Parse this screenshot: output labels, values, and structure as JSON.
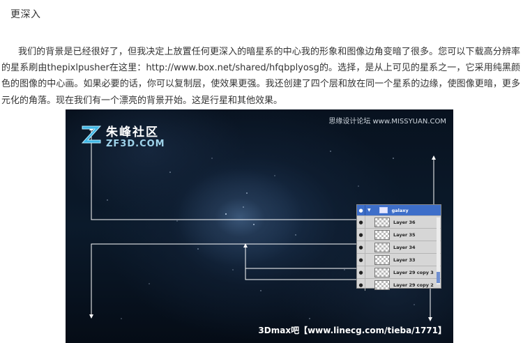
{
  "heading": "更深入",
  "paragraph": "我们的背景是已经很好了，但我决定上放置任何更深入的暗星系的中心我的形象和图像边角变暗了很多。您可以下载高分辨率的星系刷由thepixlpusher在这里：http://www.box.net/shared/hfqbplyosg的。选择，是从上可见的星系之一，它采用纯黑颜色的图像的中心画。如果必要的话，你可以复制层，使效果更强。我还创建了四个层和放在同一个星系的边缘，使图像更暗，更多元化的角落。现在我们有一个漂亮的背景开始。这是行星和其他效果。",
  "screenshot": {
    "logo_cn": "朱峰社区",
    "logo_en": "ZF3D.COM",
    "watermark_top": "思缘设计论坛 www.MISSYUAN.COM",
    "watermark_bottom": "3Dmax吧【www.linecg.com/tieba/1771】",
    "layers": [
      {
        "name": "galaxy",
        "type": "group"
      },
      {
        "name": "Layer 36",
        "type": "layer"
      },
      {
        "name": "Layer 35",
        "type": "layer"
      },
      {
        "name": "Layer 34",
        "type": "layer"
      },
      {
        "name": "Layer 33",
        "type": "layer"
      },
      {
        "name": "Layer 29 copy 3",
        "type": "layer"
      },
      {
        "name": "Layer 29 copy 2",
        "type": "layer"
      }
    ]
  },
  "colors": {
    "layer_group_highlight": "#3d6ec9",
    "logo_accent": "#3fb7e6"
  }
}
